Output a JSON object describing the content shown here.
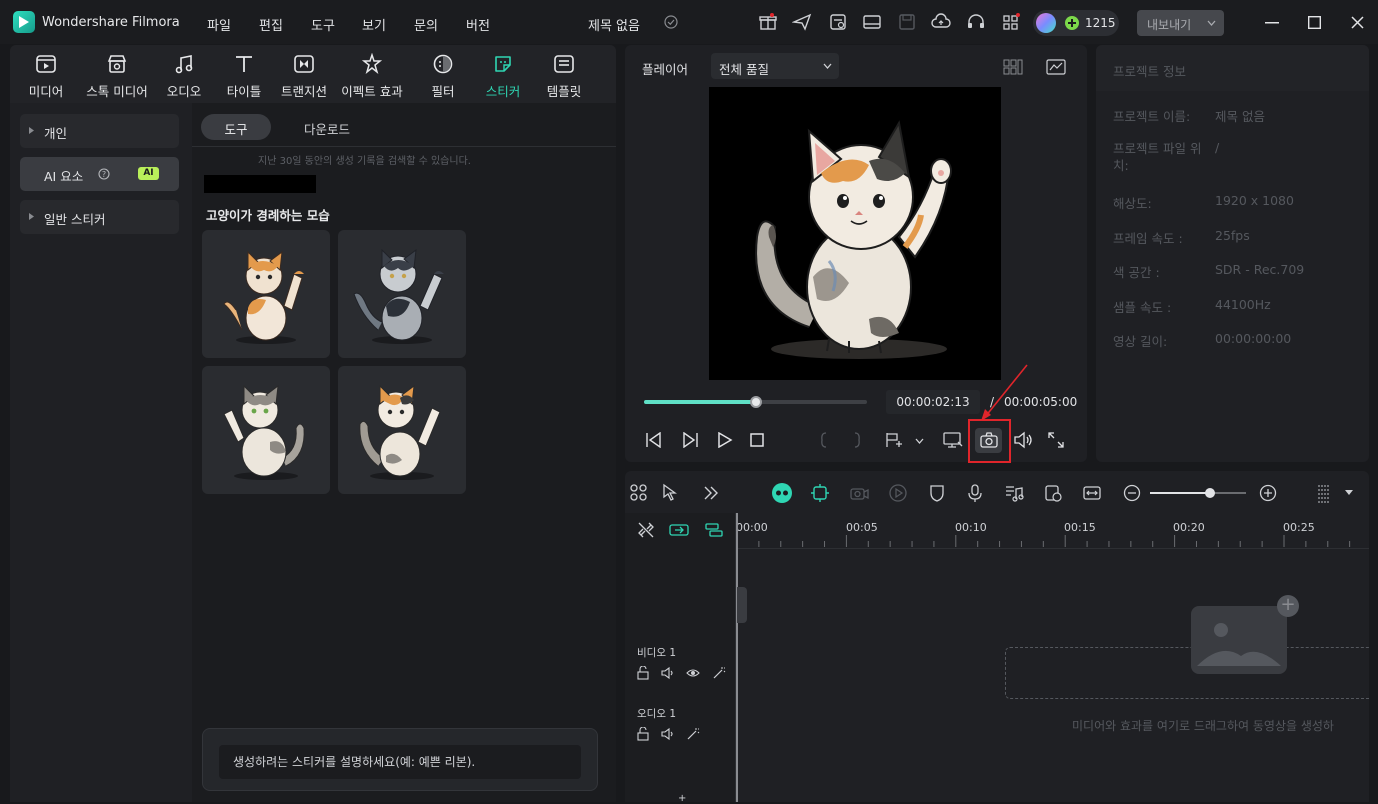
{
  "app": {
    "name": "Wondershare Filmora",
    "project_title": "제목 없음",
    "credits": "1215",
    "export_label": "내보내기"
  },
  "menu": [
    "파일",
    "편집",
    "도구",
    "보기",
    "문의",
    "버전"
  ],
  "toolbar": [
    {
      "label": "미디어",
      "icon": "media-icon"
    },
    {
      "label": "스톡 미디어",
      "icon": "stock-media-icon"
    },
    {
      "label": "오디오",
      "icon": "music-note-icon"
    },
    {
      "label": "타이틀",
      "icon": "text-t-icon"
    },
    {
      "label": "트랜지션",
      "icon": "transition-icon"
    },
    {
      "label": "이펙트 효과",
      "icon": "sparkle-star-icon"
    },
    {
      "label": "필터",
      "icon": "filter-icon"
    },
    {
      "label": "스티커",
      "icon": "sticker-icon",
      "active": true
    },
    {
      "label": "템플릿",
      "icon": "template-icon"
    }
  ],
  "sidebar": {
    "items": [
      {
        "label": "개인"
      },
      {
        "label": "AI 요소",
        "badge": "AI"
      },
      {
        "label": "일반 스티커"
      }
    ]
  },
  "tabs": {
    "tool": "도구",
    "download": "다운로드"
  },
  "history_note": "지난 30일 동안의 생성 기록을 검색할 수 있습니다.",
  "section_title": "고양이가 경례하는 모습",
  "prompt": {
    "placeholder": "생성하려는 스티커를 설명하세요(예: 예쁜 리본)."
  },
  "player": {
    "label": "플레이어",
    "quality": "전체 품질",
    "current_time": "00:00:02:13",
    "total_time": "00:00:05:00",
    "progress": 0.5
  },
  "project_info": {
    "title": "프로젝트 정보",
    "rows": [
      {
        "key": "프로젝트 이름:",
        "value": "제목 없음"
      },
      {
        "key": "프로젝트 파일 위치:",
        "value": "/"
      },
      {
        "key": "해상도:",
        "value": "1920 x 1080"
      },
      {
        "key": "프레임 속도 :",
        "value": "25fps"
      },
      {
        "key": "색 공간 :",
        "value": "SDR - Rec.709"
      },
      {
        "key": "샘플 속도 :",
        "value": "44100Hz"
      },
      {
        "key": "영상 길이:",
        "value": "00:00:00:00"
      }
    ]
  },
  "timeline": {
    "ruler": [
      "00:00",
      "00:05",
      "00:10",
      "00:15",
      "00:20",
      "00:25"
    ],
    "tracks": [
      {
        "label": "비디오 1"
      },
      {
        "label": "오디오 1"
      }
    ],
    "drop_hint": "미디어와 효과를 여기로 드래그하여 동영상을 생성하"
  },
  "colors": {
    "accent": "#2fd6b3",
    "highlight_box": "#e0252b",
    "panel": "#1f2024"
  }
}
